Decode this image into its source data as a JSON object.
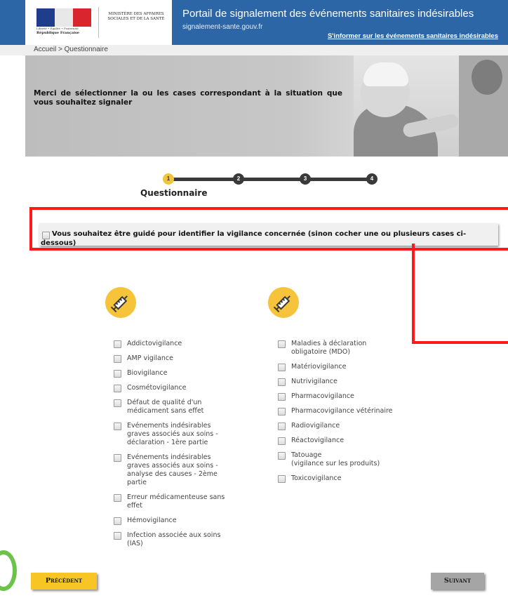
{
  "header": {
    "republique": "République Française",
    "motto": "Liberté • Égalité • Fraternité",
    "ministry": "Ministère des Affaires Sociales et de la Santé",
    "title": "Portail de signalement des événements sanitaires indésirables",
    "url": "signalement-sante.gouv.fr",
    "info_link": "S'informer sur les événements sanitaires indésirables",
    "colors": {
      "bar": "#2d66a6"
    }
  },
  "breadcrumb": "Accueil > Questionnaire",
  "banner": {
    "text": "Merci de sélectionner la ou les cases correspondant à la situation que vous souhaitez signaler"
  },
  "stepper": {
    "steps": [
      "1",
      "2",
      "3",
      "4"
    ],
    "active_step": 1,
    "label": "Questionnaire",
    "colors": {
      "active": "#f2c43c",
      "inactive": "#3a3a3a"
    }
  },
  "guided": {
    "label": "Vous souhaitez être guidé pour identifier la vigilance concernée (sinon cocher une ou plusieurs cases ci-dessous)"
  },
  "icons": {
    "left_column": "syringe-icon",
    "right_column": "syringe-icon"
  },
  "left_items": [
    "Addictovigilance",
    "AMP vigilance",
    "Biovigilance",
    "Cosmétovigilance",
    "Défaut de qualité d'un\nmédicament sans effet",
    "Evénements indésirables\ngraves associés aux soins -\ndéclaration - 1ère partie",
    "Evénements indésirables\ngraves associés aux soins -\nanalyse des causes - 2ème\npartie",
    "Erreur médicamenteuse sans\neffet",
    "Hémovigilance",
    "Infection associée aux soins\n(IAS)"
  ],
  "right_items": [
    "Maladies à déclaration\nobligatoire (MDO)",
    "Matériovigilance",
    "Nutrivigilance",
    "Pharmacovigilance",
    "Pharmacovigilance vétérinaire",
    "Radiovigilance",
    "Réactovigilance",
    "Tatouage\n(vigilance sur les produits)",
    "Toxicovigilance"
  ],
  "buttons": {
    "previous": "Précédent",
    "next": "Suivant"
  },
  "colors": {
    "accent_yellow": "#f7c624",
    "highlight_red": "#ff1a1a",
    "next_grey": "#a5a5a5"
  }
}
